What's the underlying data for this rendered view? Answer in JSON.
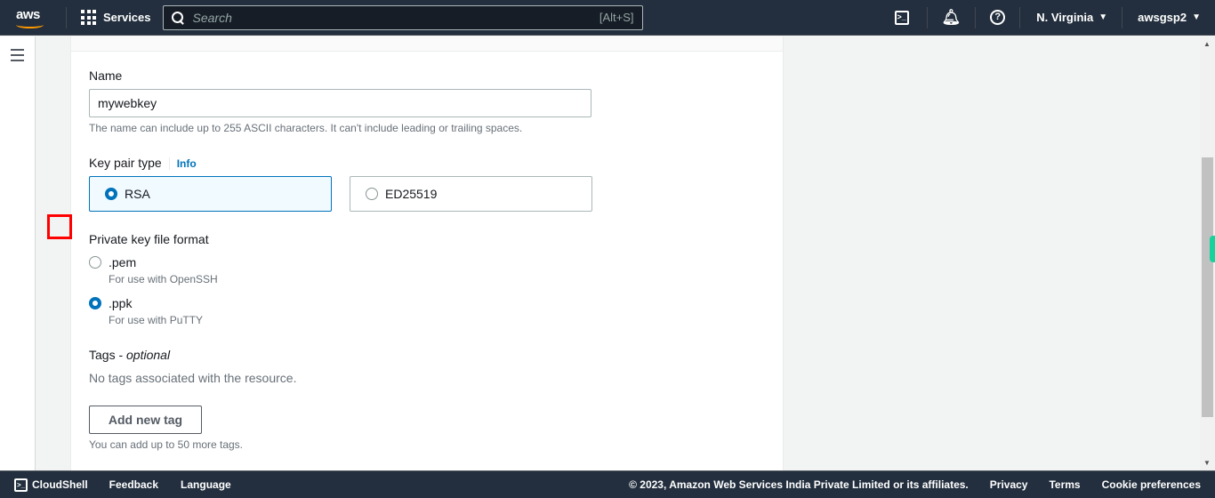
{
  "topnav": {
    "logo": "aws",
    "services_label": "Services",
    "search_placeholder": "Search",
    "search_shortcut": "[Alt+S]",
    "region": "N. Virginia",
    "account": "awsgsp2",
    "icons": [
      "cloudshell-icon",
      "notifications-bell-icon",
      "help-icon"
    ]
  },
  "form": {
    "name_label": "Name",
    "name_value": "mywebkey",
    "name_hint": "The name can include up to 255 ASCII characters. It can't include leading or trailing spaces.",
    "key_pair_type_label": "Key pair type",
    "info_link": "Info",
    "key_pair_types": [
      {
        "label": "RSA",
        "selected": true
      },
      {
        "label": "ED25519",
        "selected": false
      }
    ],
    "file_format_label": "Private key file format",
    "file_formats": [
      {
        "label": ".pem",
        "description": "For use with OpenSSH",
        "selected": false
      },
      {
        "label": ".ppk",
        "description": "For use with PuTTY",
        "selected": true
      }
    ],
    "tags_label": "Tags - ",
    "tags_optional": "optional",
    "tags_empty": "No tags associated with the resource.",
    "add_tag_button": "Add new tag",
    "tags_hint": "You can add up to 50 more tags."
  },
  "footer": {
    "cloudshell": "CloudShell",
    "feedback": "Feedback",
    "language": "Language",
    "copyright": "© 2023, Amazon Web Services India Private Limited or its affiliates.",
    "privacy": "Privacy",
    "terms": "Terms",
    "cookie_preferences": "Cookie preferences"
  }
}
